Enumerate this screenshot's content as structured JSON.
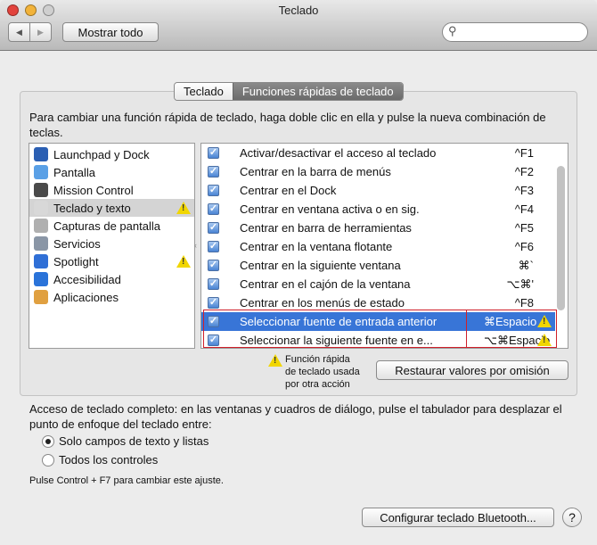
{
  "window": {
    "title": "Teclado"
  },
  "toolbar": {
    "back": "◀",
    "forward": "▶",
    "show_all": "Mostrar todo",
    "search_placeholder": ""
  },
  "tabs": [
    {
      "label": "Teclado",
      "selected": false
    },
    {
      "label": "Funciones rápidas de teclado",
      "selected": true
    }
  ],
  "instructions": "Para cambiar una función rápida de teclado, haga doble clic en ella y pulse la nueva combinación de teclas.",
  "categories": [
    {
      "label": "Launchpad y Dock",
      "icon": "launchpad-icon",
      "color": "#2b5fb3",
      "warning": false
    },
    {
      "label": "Pantalla",
      "icon": "display-icon",
      "color": "#5aa0e6",
      "warning": false
    },
    {
      "label": "Mission Control",
      "icon": "mission-control-icon",
      "color": "#4a4a4a",
      "warning": false
    },
    {
      "label": "Teclado y texto",
      "icon": "keyboard-icon",
      "color": "#d8d8d8",
      "warning": true,
      "selected": true
    },
    {
      "label": "Capturas de pantalla",
      "icon": "screenshot-icon",
      "color": "#b0b0b0",
      "warning": false
    },
    {
      "label": "Servicios",
      "icon": "gear-icon",
      "color": "#8a96a6",
      "warning": false
    },
    {
      "label": "Spotlight",
      "icon": "spotlight-icon",
      "color": "#2f6fd6",
      "warning": true
    },
    {
      "label": "Accesibilidad",
      "icon": "accessibility-icon",
      "color": "#2a73d9",
      "warning": false
    },
    {
      "label": "Aplicaciones",
      "icon": "applications-icon",
      "color": "#e0a040",
      "warning": false
    }
  ],
  "shortcuts": [
    {
      "name": "Activar/desactivar el acceso al teclado",
      "key": "^F1",
      "checked": true
    },
    {
      "name": "Centrar en la barra de menús",
      "key": "^F2",
      "checked": true
    },
    {
      "name": "Centrar en el Dock",
      "key": "^F3",
      "checked": true
    },
    {
      "name": "Centrar en ventana activa o en sig.",
      "key": "^F4",
      "checked": true
    },
    {
      "name": "Centrar en barra de herramientas",
      "key": "^F5",
      "checked": true
    },
    {
      "name": "Centrar en la ventana flotante",
      "key": "^F6",
      "checked": true
    },
    {
      "name": "Centrar en la siguiente ventana",
      "key": "⌘`",
      "checked": true
    },
    {
      "name": "Centrar en el cajón de la ventana",
      "key": "⌥⌘'",
      "checked": true
    },
    {
      "name": "Centrar en los menús de estado",
      "key": "^F8",
      "checked": true
    },
    {
      "name": "Seleccionar fuente de entrada anterior",
      "key": "⌘Espacio",
      "checked": true,
      "warning": true,
      "selected": true
    },
    {
      "name": "Seleccionar la siguiente fuente en e...",
      "key": "⌥⌘Espacio",
      "checked": true,
      "warning": true
    }
  ],
  "legend": {
    "line1": "Función rápida",
    "line2": "de teclado usada",
    "line3": "por otra acción"
  },
  "restore_button": "Restaurar valores por omisión",
  "full_access": {
    "text": "Acceso de teclado completo: en las ventanas y cuadros de diálogo, pulse el tabulador para desplazar el punto de enfoque del teclado entre:",
    "options": [
      {
        "label": "Solo campos de texto y listas",
        "selected": true
      },
      {
        "label": "Todos los controles",
        "selected": false
      }
    ],
    "hint": "Pulse Control + F7 para cambiar este ajuste."
  },
  "bluetooth_button": "Configurar teclado Bluetooth...",
  "help_button": "?",
  "colors": {
    "selection": "#3875d7",
    "warning": "#f1d600",
    "conflict_border": "#d0202a"
  }
}
